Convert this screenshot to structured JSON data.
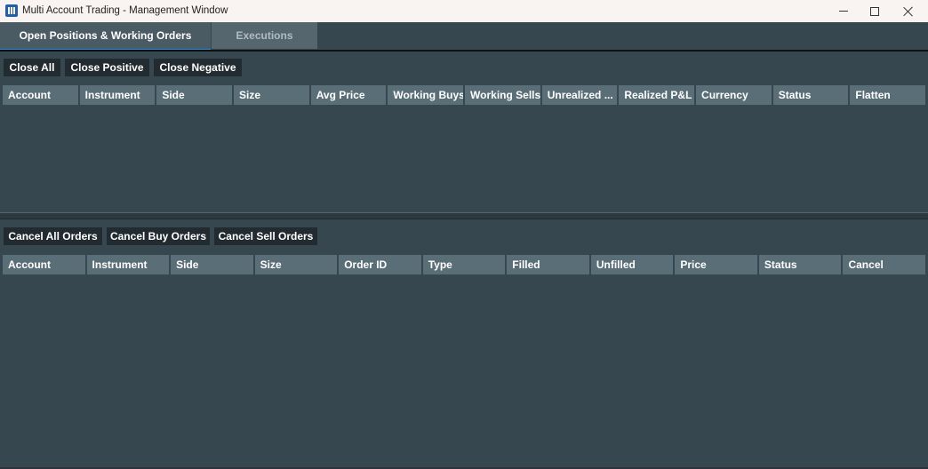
{
  "window": {
    "title": "Multi Account Trading - Management Window",
    "icon": "app-icon"
  },
  "tabs": [
    {
      "label": "Open Positions & Working Orders",
      "active": true
    },
    {
      "label": "Executions",
      "active": false
    }
  ],
  "positions": {
    "buttons": {
      "close_all": "Close All",
      "close_positive": "Close Positive",
      "close_negative": "Close Negative"
    },
    "columns": [
      "Account",
      "Instrument",
      "Side",
      "Size",
      "Avg Price",
      "Working Buys",
      "Working Sells",
      "Unrealized ...",
      "Realized P&L",
      "Currency",
      "Status",
      "Flatten"
    ],
    "rows": []
  },
  "orders": {
    "buttons": {
      "cancel_all": "Cancel All Orders",
      "cancel_buy": "Cancel Buy Orders",
      "cancel_sell": "Cancel Sell Orders"
    },
    "columns": [
      "Account",
      "Instrument",
      "Side",
      "Size",
      "Order ID",
      "Type",
      "Filled",
      "Unfilled",
      "Price",
      "Status",
      "Cancel"
    ],
    "rows": []
  },
  "colors": {
    "background": "#37474f",
    "header_cell": "#5a6e78",
    "button": "#222b30",
    "tab_accent": "#1e88e5"
  }
}
